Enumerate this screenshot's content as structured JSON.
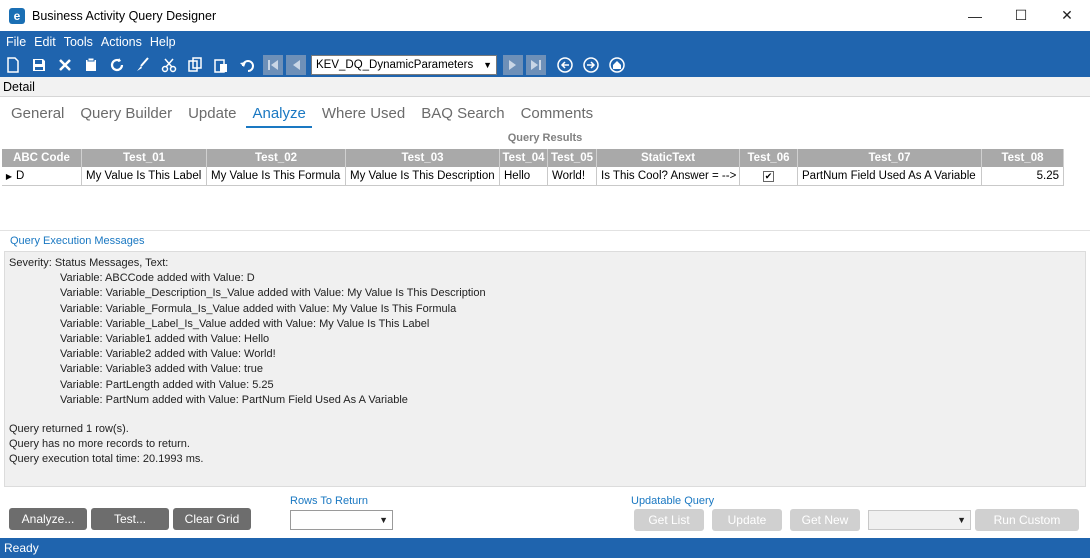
{
  "window": {
    "title": "Business Activity Query Designer",
    "logo_letter": "e",
    "minimize": "—",
    "maximize": "☐",
    "close": "✕"
  },
  "menu": [
    "File",
    "Edit",
    "Tools",
    "Actions",
    "Help"
  ],
  "toolbar": {
    "query_select_value": "KEV_DQ_DynamicParameters"
  },
  "detail_label": "Detail",
  "tabs": [
    {
      "label": "General",
      "active": false
    },
    {
      "label": "Query Builder",
      "active": false
    },
    {
      "label": "Update",
      "active": false
    },
    {
      "label": "Analyze",
      "active": true
    },
    {
      "label": "Where Used",
      "active": false
    },
    {
      "label": "BAQ Search",
      "active": false
    },
    {
      "label": "Comments",
      "active": false
    }
  ],
  "results": {
    "title": "Query Results",
    "columns": [
      "ABC Code",
      "Test_01",
      "Test_02",
      "Test_03",
      "Test_04",
      "Test_05",
      "StaticText",
      "Test_06",
      "Test_07",
      "Test_08"
    ],
    "rows": [
      [
        "D",
        "My Value Is This Label",
        "My Value Is This Formula",
        "My Value Is This Description",
        "Hello",
        "World!",
        "Is This Cool? Answer = -->",
        "✔",
        "PartNum Field Used As A Variable",
        "5.25"
      ]
    ]
  },
  "messages": {
    "title": "Query Execution Messages",
    "header": "Severity: Status Messages, Text:",
    "variables": [
      "Variable: ABCCode added with Value: D",
      "Variable: Variable_Description_Is_Value added with Value: My Value Is This Description",
      "Variable: Variable_Formula_Is_Value added with Value: My Value Is This Formula",
      "Variable: Variable_Label_Is_Value added with Value: My Value Is This Label",
      "Variable: Variable1 added with Value: Hello",
      "Variable: Variable2 added with Value: World!",
      "Variable: Variable3 added with Value: true",
      "Variable: PartLength added with Value: 5.25",
      "Variable: PartNum added with Value: PartNum Field Used As A Variable"
    ],
    "footer": [
      "Query returned 1 row(s).",
      "Query has no more records to return.",
      "Query execution total time: 20.1993 ms."
    ]
  },
  "bottom": {
    "analyze_btn": "Analyze...",
    "test_btn": "Test...",
    "clear_btn": "Clear Grid",
    "rows_to_return_label": "Rows To Return",
    "rows_to_return_value": "",
    "updatable_query_label": "Updatable Query",
    "get_list_btn": "Get List",
    "update_btn": "Update",
    "get_new_btn": "Get New",
    "run_custom_btn": "Run Custom"
  },
  "status": "Ready",
  "colors": {
    "accent_blue": "#1f64ae",
    "tab_active": "#1a78c2",
    "grid_header": "#a9a9a9"
  }
}
